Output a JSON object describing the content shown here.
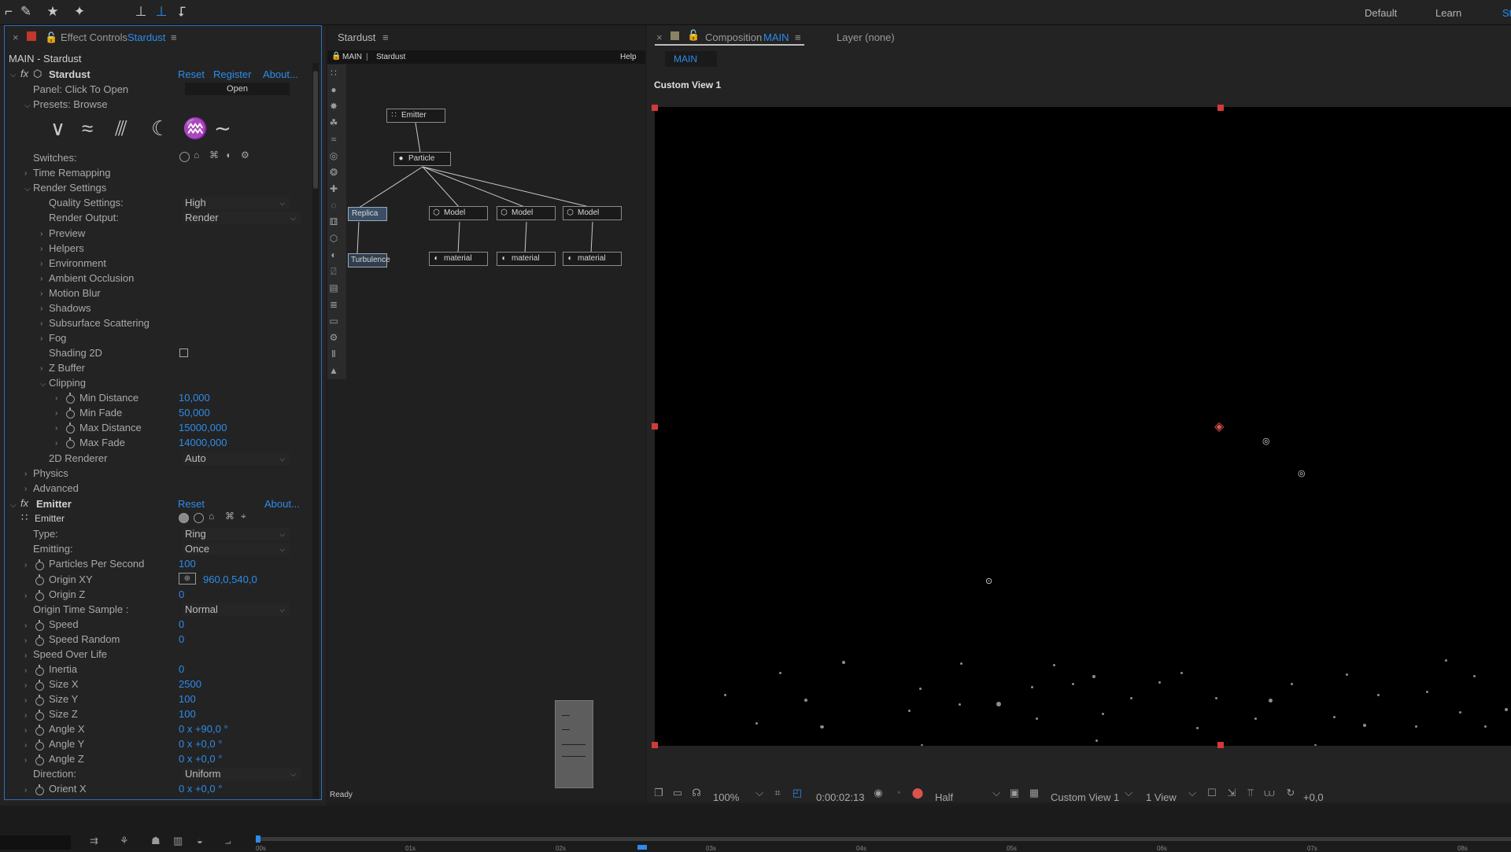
{
  "workspace": {
    "default": "Default",
    "learn": "Learn",
    "cut": "St"
  },
  "effect_controls": {
    "title": "Effect Controls",
    "layer": "Stardust",
    "breadcrumb": "MAIN - Stardust",
    "stardust": {
      "name": "Stardust",
      "reset": "Reset",
      "register": "Register",
      "about": "About...",
      "panel_label": "Panel: Click To Open",
      "open_label": "Open",
      "presets_label": "Presets: Browse",
      "switches_label": "Switches:",
      "time_remapping": "Time Remapping",
      "render_settings": "Render Settings",
      "quality_label": "Quality Settings:",
      "quality_value": "High",
      "render_output_label": "Render Output:",
      "render_output_value": "Render",
      "sub": [
        "Preview",
        "Helpers",
        "Environment",
        "Ambient Occlusion",
        "Motion Blur",
        "Shadows",
        "Subsurface Scattering",
        "Fog"
      ],
      "shading_2d": "Shading 2D",
      "z_buffer": "Z Buffer",
      "clipping": "Clipping",
      "min_distance_label": "Min Distance",
      "min_distance_value": "10,000",
      "min_fade_label": "Min Fade",
      "min_fade_value": "50,000",
      "max_distance_label": "Max Distance",
      "max_distance_value": "15000,000",
      "max_fade_label": "Max Fade",
      "max_fade_value": "14000,000",
      "renderer_2d_label": "2D Renderer",
      "renderer_2d_value": "Auto",
      "physics": "Physics",
      "advanced": "Advanced"
    },
    "emitter": {
      "name": "Emitter",
      "reset": "Reset",
      "about": "About...",
      "sub_name": "Emitter",
      "type_label": "Type:",
      "type_value": "Ring",
      "emitting_label": "Emitting:",
      "emitting_value": "Once",
      "pps_label": "Particles Per Second",
      "pps_value": "100",
      "origin_xy_label": "Origin XY",
      "origin_xy_value": "960,0,540,0",
      "origin_z_label": "Origin Z",
      "origin_z_value": "0",
      "ots_label": "Origin Time Sample :",
      "ots_value": "Normal",
      "speed_label": "Speed",
      "speed_value": "0",
      "speed_random_label": "Speed Random",
      "speed_random_value": "0",
      "speed_over_life": "Speed Over Life",
      "inertia_label": "Inertia",
      "inertia_value": "0",
      "size_x_label": "Size X",
      "size_x_value": "2500",
      "size_y_label": "Size Y",
      "size_y_value": "100",
      "size_z_label": "Size Z",
      "size_z_value": "100",
      "angle_x_label": "Angle X",
      "angle_x_value": "0 x +90,0 °",
      "angle_y_label": "Angle Y",
      "angle_y_value": "0 x +0,0 °",
      "angle_z_label": "Angle Z",
      "angle_z_value": "0 x +0,0 °",
      "direction_label": "Direction:",
      "direction_value": "Uniform",
      "orient_x_label": "Orient X",
      "orient_x_value": "0 x +0,0 °"
    }
  },
  "stardust_panel": {
    "title": "Stardust",
    "tab_main": "MAIN",
    "tab_sep": "|",
    "tab_stardust": "Stardust",
    "help": "Help",
    "status": "Ready",
    "nodes": {
      "emitter": "Emitter",
      "particle": "Particle",
      "replica": "Replica",
      "turbulence": "Turbulence",
      "model1": "Model",
      "model2": "Model",
      "model3": "Model",
      "material1": "material",
      "material2": "material",
      "material3": "material"
    }
  },
  "composition": {
    "label": "Composition",
    "name": "MAIN",
    "layer_label": "Layer (none)",
    "tab": "MAIN",
    "view_label": "Custom View 1",
    "zoom": "100%",
    "timecode": "0:00:02:13",
    "resolution": "Half",
    "view_dropdown": "Custom View 1",
    "views": "1 View",
    "exposure": "+0,0"
  },
  "timeline": {
    "ticks": [
      "00s",
      "01s",
      "02s",
      "03s",
      "04s",
      "05s",
      "06s",
      "07s",
      "08s"
    ]
  },
  "colors": {
    "accent": "#2d8ceb",
    "handle": "#d23a3a"
  }
}
